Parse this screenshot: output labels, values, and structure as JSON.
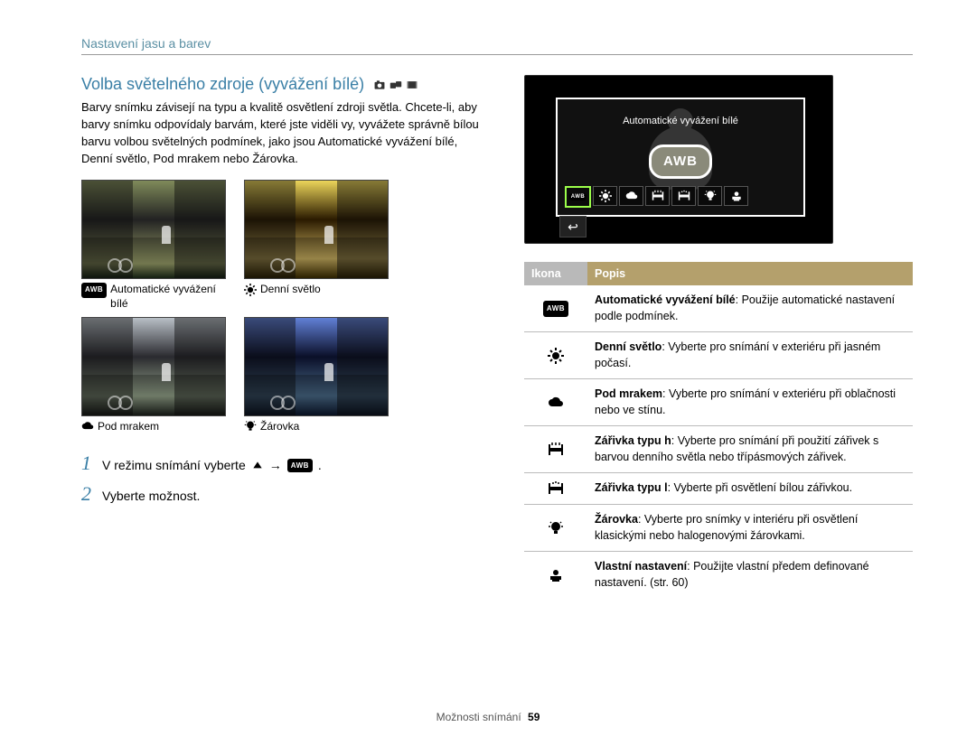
{
  "breadcrumb": "Nastavení jasu a barev",
  "section_title": "Volba světelného zdroje (vyvážení bílé)",
  "mode_icons": [
    "camera-icon",
    "dual-icon",
    "film-icon"
  ],
  "intro": "Barvy snímku závisejí na typu a kvalitě osvětlení zdroji světla. Chcete-li, aby barvy snímku odpovídaly barvám, které jste viděli vy, vyvážete správně bílou barvu volbou světelných podmínek, jako jsou Automatické vyvážení bílé, Denní světlo, Pod mrakem nebo Žárovka.",
  "examples": [
    {
      "label": "Automatické vyvážení bílé",
      "icon": "awb"
    },
    {
      "label": "Denní světlo",
      "icon": "sun"
    },
    {
      "label": "Pod mrakem",
      "icon": "cloud"
    },
    {
      "label": "Žárovka",
      "icon": "bulb"
    }
  ],
  "steps": [
    {
      "num": "1",
      "text_before": "V režimu snímání vyberte",
      "icon1": "menu-up",
      "arrow": "→",
      "icon2": "awb",
      "text_after": "."
    },
    {
      "num": "2",
      "text_before": "Vyberte možnost.",
      "icon1": "",
      "arrow": "",
      "icon2": "",
      "text_after": ""
    }
  ],
  "screenshot": {
    "label": "Automatické vyvážení bílé",
    "badge": "AWB",
    "option_icons": [
      "awb",
      "sun",
      "cloud",
      "fluor-h",
      "fluor-l",
      "bulb",
      "custom"
    ],
    "back": "↩"
  },
  "table": {
    "head_icon": "Ikona",
    "head_desc": "Popis",
    "rows": [
      {
        "icon": "awb",
        "title": "Automatické vyvážení bílé",
        "text": ": Použije automatické nastavení podle podmínek."
      },
      {
        "icon": "sun",
        "title": "Denní světlo",
        "text": ": Vyberte pro snímání v exteriéru při jasném počasí."
      },
      {
        "icon": "cloud",
        "title": "Pod mrakem",
        "text": ": Vyberte pro snímání v exteriéru při oblačnosti nebo ve stínu."
      },
      {
        "icon": "fluor-h",
        "title": "Zářivka typu h",
        "text": ": Vyberte pro snímání při použití zářivek s barvou denního světla nebo třípásmových zářivek."
      },
      {
        "icon": "fluor-l",
        "title": "Zářivka typu l",
        "text": ": Vyberte při osvětlení bílou zářivkou."
      },
      {
        "icon": "bulb",
        "title": "Žárovka",
        "text": ": Vyberte pro snímky v interiéru při osvětlení klasickými nebo halogenovými žárovkami."
      },
      {
        "icon": "custom",
        "title": "Vlastní nastavení",
        "text": ": Použijte vlastní předem definované nastavení. (str. 60)"
      }
    ]
  },
  "footer_label": "Možnosti snímání",
  "footer_page": "59"
}
